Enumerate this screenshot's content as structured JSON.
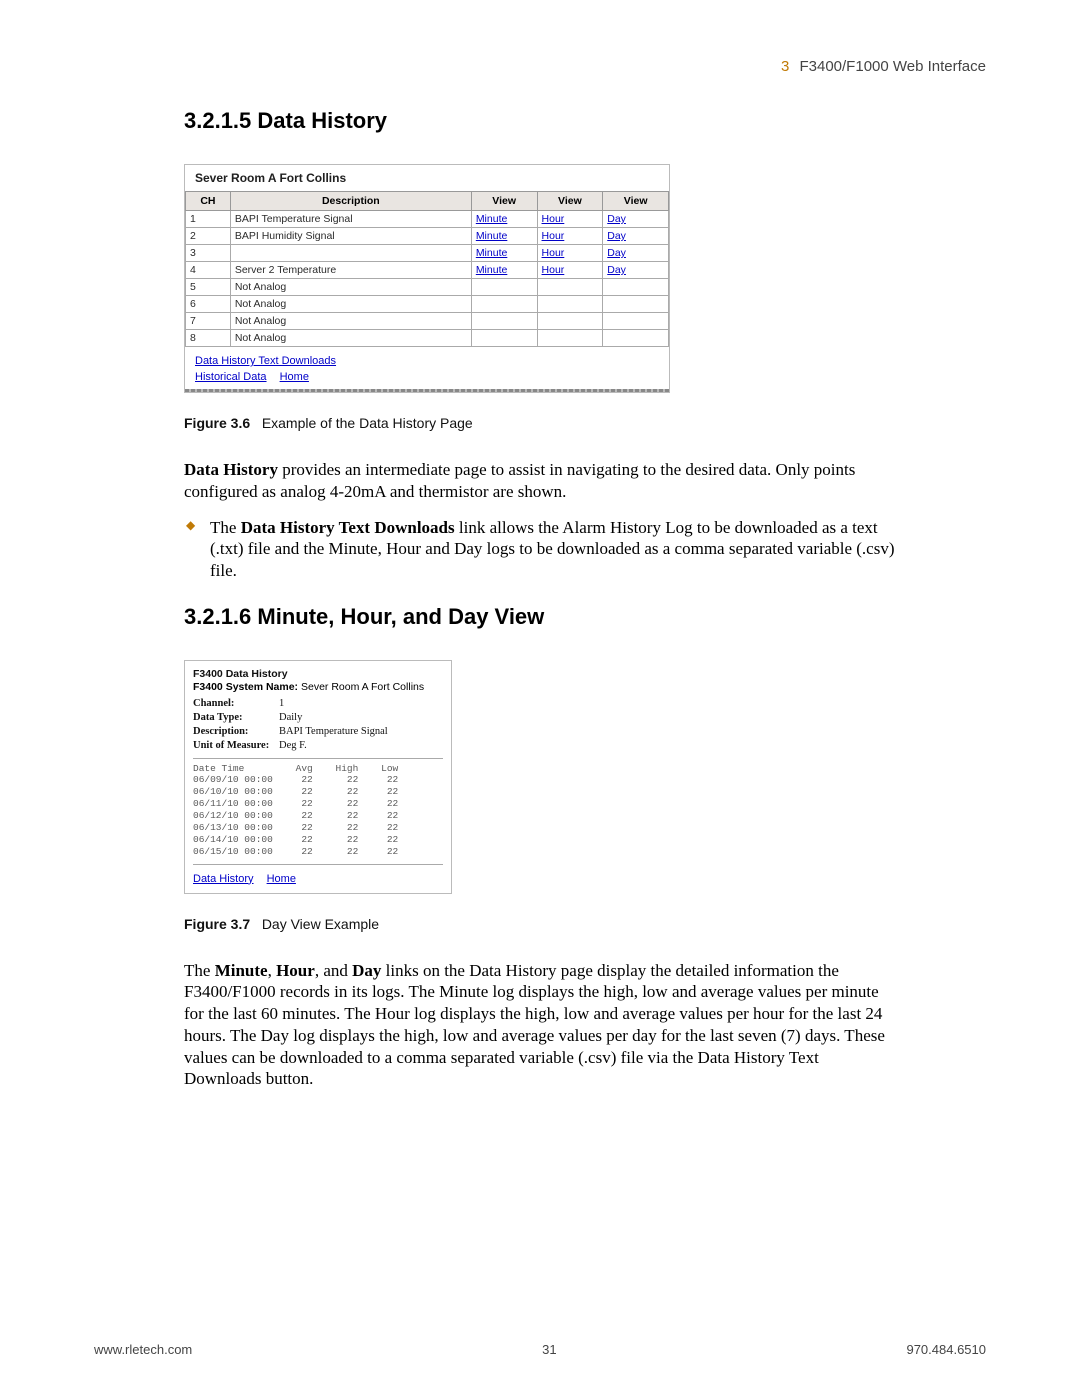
{
  "breadcrumb": {
    "chapter": "3",
    "title": "F3400/F1000 Web Interface"
  },
  "section1": {
    "number": "3.2.1.5",
    "title": "Data History"
  },
  "section2": {
    "number": "3.2.1.6",
    "title": "Minute, Hour, and Day View"
  },
  "fig1": {
    "room_title": "Sever Room A Fort Collins",
    "headers": {
      "ch": "CH",
      "desc": "Description",
      "v1": "View",
      "v2": "View",
      "v3": "View"
    },
    "rows": [
      {
        "ch": "1",
        "desc": "BAPI Temperature Signal",
        "v1": "Minute",
        "v2": "Hour",
        "v3": "Day",
        "analog": true
      },
      {
        "ch": "2",
        "desc": "BAPI Humidity Signal",
        "v1": "Minute",
        "v2": "Hour",
        "v3": "Day",
        "analog": true
      },
      {
        "ch": "3",
        "desc": "",
        "v1": "Minute",
        "v2": "Hour",
        "v3": "Day",
        "analog": true
      },
      {
        "ch": "4",
        "desc": "Server 2 Temperature",
        "v1": "Minute",
        "v2": "Hour",
        "v3": "Day",
        "analog": true
      },
      {
        "ch": "5",
        "desc": "Not Analog",
        "v1": "",
        "v2": "",
        "v3": "",
        "analog": false
      },
      {
        "ch": "6",
        "desc": "Not Analog",
        "v1": "",
        "v2": "",
        "v3": "",
        "analog": false
      },
      {
        "ch": "7",
        "desc": "Not Analog",
        "v1": "",
        "v2": "",
        "v3": "",
        "analog": false
      },
      {
        "ch": "8",
        "desc": "Not Analog",
        "v1": "",
        "v2": "",
        "v3": "",
        "analog": false
      }
    ],
    "link_downloads": "Data History Text Downloads",
    "link_historical": "Historical Data",
    "link_home": "Home"
  },
  "caption1": {
    "label": "Figure 3.6",
    "text": "Example of the Data History Page"
  },
  "para1_lead": "Data History",
  "para1_rest": " provides an intermediate page to assist in navigating to the desired data. Only points configured as analog 4-20mA and thermistor are shown.",
  "bullet1_lead": "Data History Text Downloads",
  "bullet1_pre": "The ",
  "bullet1_rest": " link allows the Alarm History Log to be downloaded as a text (.txt) file and the Minute, Hour and Day logs to be downloaded as a comma separated variable (.csv) file.",
  "fig2": {
    "title": "F3400 Data History",
    "sysname_label": "F3400 System Name:",
    "sysname_value": "Sever Room A Fort Collins",
    "kv": [
      {
        "k": "Channel:",
        "v": "1"
      },
      {
        "k": "Data Type:",
        "v": "Daily"
      },
      {
        "k": "Description:",
        "v": "BAPI Temperature Signal"
      },
      {
        "k": "Unit of Measure:",
        "v": "Deg F."
      }
    ],
    "log_header": "Date Time         Avg    High    Low",
    "log_rows": [
      "06/09/10 00:00     22      22     22",
      "06/10/10 00:00     22      22     22",
      "06/11/10 00:00     22      22     22",
      "06/12/10 00:00     22      22     22",
      "06/13/10 00:00     22      22     22",
      "06/14/10 00:00     22      22     22",
      "06/15/10 00:00     22      22     22"
    ],
    "link_history": "Data History",
    "link_home": "Home"
  },
  "caption2": {
    "label": "Figure 3.7",
    "text": "Day View Example"
  },
  "para2": "The Minute, Hour, and Day links on the Data History page display the detailed information the F3400/F1000 records in its logs. The Minute log displays the high, low and average values per minute for the last 60 minutes. The Hour log displays the high, low and average values per hour for the last 24 hours. The Day log displays the high, low and average values per day for the last seven (7) days. These values can be downloaded to a comma separated variable (.csv) file via the Data History Text Downloads button.",
  "para2_bold": {
    "w1": "Minute",
    "w2": "Hour",
    "w3": "Day"
  },
  "footer": {
    "left": "www.rletech.com",
    "center": "31",
    "right": "970.484.6510"
  },
  "chart_data": {
    "type": "table",
    "title": "F3400 Data History — Channel 1 Daily (Deg F.)",
    "columns": [
      "Date Time",
      "Avg",
      "High",
      "Low"
    ],
    "rows": [
      [
        "06/09/10 00:00",
        22,
        22,
        22
      ],
      [
        "06/10/10 00:00",
        22,
        22,
        22
      ],
      [
        "06/11/10 00:00",
        22,
        22,
        22
      ],
      [
        "06/12/10 00:00",
        22,
        22,
        22
      ],
      [
        "06/13/10 00:00",
        22,
        22,
        22
      ],
      [
        "06/14/10 00:00",
        22,
        22,
        22
      ],
      [
        "06/15/10 00:00",
        22,
        22,
        22
      ]
    ]
  }
}
